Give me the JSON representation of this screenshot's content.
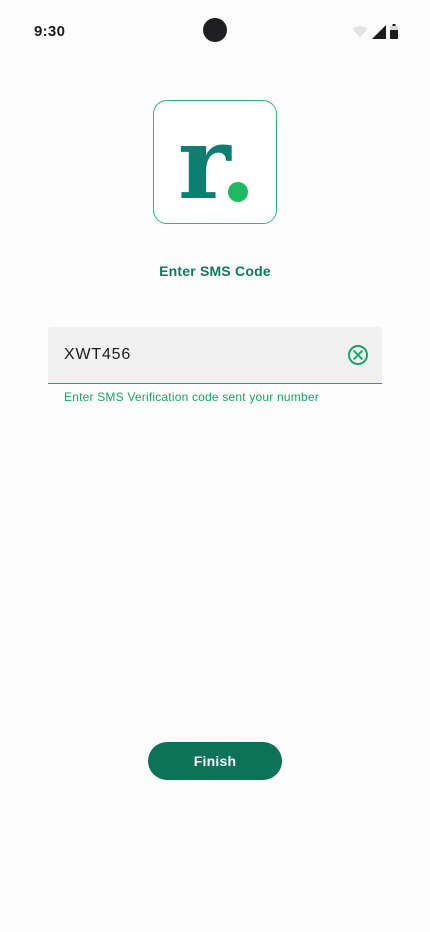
{
  "status_bar": {
    "time": "9:30",
    "icons": [
      "wifi-icon",
      "cellular-signal-icon",
      "battery-icon"
    ]
  },
  "logo": {
    "letter": "r",
    "letter_color": "#0e7e73",
    "dot_color": "#1dbb5f",
    "border_color": "#2fb67f"
  },
  "title": "Enter SMS Code",
  "sms_field": {
    "value": "XWT456",
    "helper_text": "Enter SMS Verification code sent your number",
    "clear_icon": "clear-circle-icon"
  },
  "finish_button": {
    "label": "Finish"
  },
  "colors": {
    "accent_green": "#16a56a",
    "primary_button": "#0c7258",
    "title_text": "#107a5f",
    "field_background": "#f1f1f2"
  }
}
